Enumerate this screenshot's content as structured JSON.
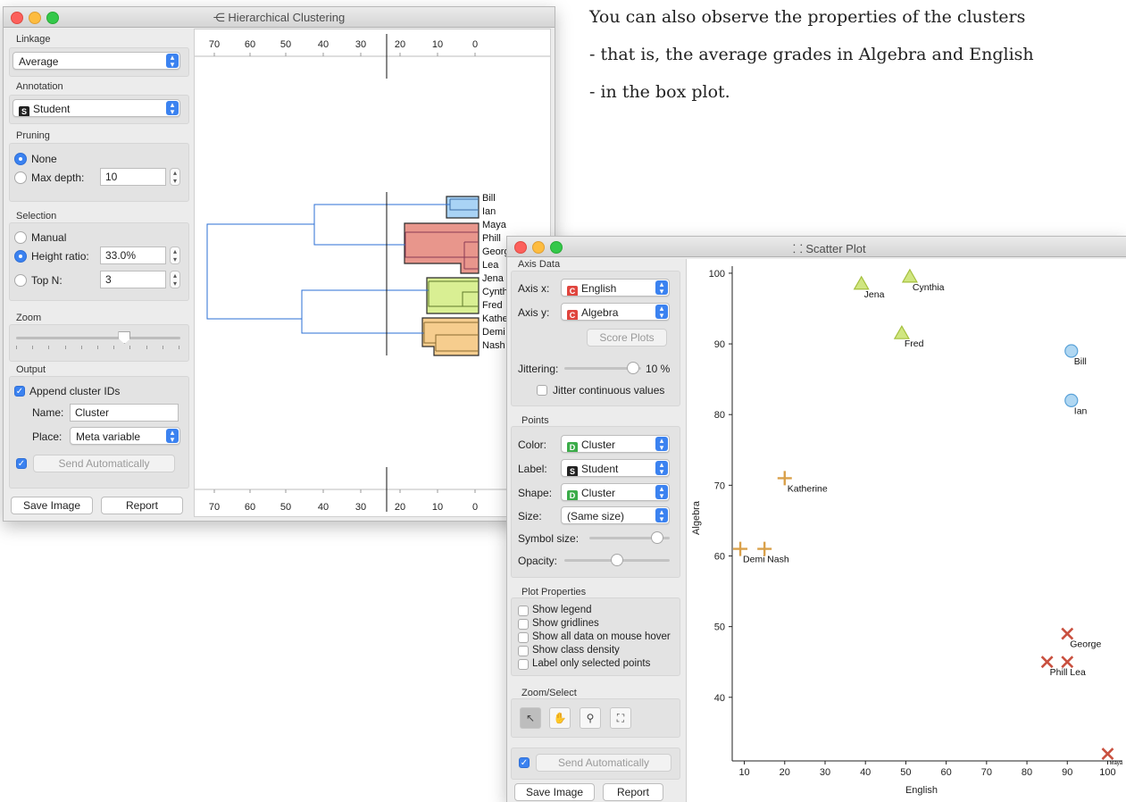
{
  "narrative": {
    "line1": "You can also observe the properties of the clusters",
    "line2": "- that is, the average grades in Algebra and English",
    "line3": "- in the box plot."
  },
  "hc": {
    "title": "Hierarchical Clustering",
    "linkage_label": "Linkage",
    "linkage_value": "Average",
    "annotation_label": "Annotation",
    "annotation_value": "Student",
    "pruning_label": "Pruning",
    "pruning_none": "None",
    "pruning_maxdepth": "Max depth:",
    "pruning_maxdepth_value": "10",
    "selection_label": "Selection",
    "sel_manual": "Manual",
    "sel_height": "Height ratio:",
    "sel_height_value": "33.0%",
    "sel_topn": "Top N:",
    "sel_topn_value": "3",
    "zoom_label": "Zoom",
    "zoom_value": 0.66,
    "output_label": "Output",
    "append_ids": "Append cluster IDs",
    "name_label": "Name:",
    "name_value": "Cluster",
    "place_label": "Place:",
    "place_value": "Meta variable",
    "send_auto": "Send Automatically",
    "save_image": "Save Image",
    "report": "Report",
    "axis_ticks": [
      "70",
      "60",
      "50",
      "40",
      "30",
      "20",
      "10",
      "0"
    ],
    "leaves": [
      "Bill",
      "Ian",
      "Maya",
      "Phill",
      "Georg",
      "Lea",
      "Jena",
      "Cynth",
      "Fred",
      "Kathe",
      "Demi",
      "Nash"
    ],
    "cluster_colors": {
      "blue": "#a9d3f5",
      "red": "#e8968c",
      "green": "#d9ef93",
      "orange": "#f6cd8e"
    }
  },
  "sp": {
    "title": "Scatter Plot",
    "axis_data_label": "Axis Data",
    "axis_x_label": "Axis x:",
    "axis_x_value": "English",
    "axis_y_label": "Axis y:",
    "axis_y_value": "Algebra",
    "score_plots": "Score Plots",
    "jittering_label": "Jittering:",
    "jittering_value": "10 %",
    "jitter_level": 0.9,
    "jitter_cont": "Jitter continuous values",
    "points_label": "Points",
    "color_label": "Color:",
    "color_value": "Cluster",
    "label_label": "Label:",
    "label_value": "Student",
    "shape_label": "Shape:",
    "shape_value": "Cluster",
    "size_label": "Size:",
    "size_value": "(Same size)",
    "symbol_size_label": "Symbol size:",
    "symbol_size_level": 0.84,
    "opacity_label": "Opacity:",
    "opacity_level": 0.5,
    "plot_props_label": "Plot Properties",
    "props": [
      "Show legend",
      "Show gridlines",
      "Show all data on mouse hover",
      "Show class density",
      "Label only selected points"
    ],
    "zoom_select_label": "Zoom/Select",
    "send_auto": "Send Automatically",
    "save_image": "Save Image",
    "report": "Report"
  },
  "chart_data": {
    "type": "scatter",
    "title": "",
    "xlabel": "English",
    "ylabel": "Algebra",
    "xlim": [
      7,
      101
    ],
    "ylim": [
      31,
      101
    ],
    "xticks": [
      10,
      20,
      30,
      40,
      50,
      60,
      70,
      80,
      90,
      100
    ],
    "yticks": [
      40,
      50,
      60,
      70,
      80,
      90,
      100
    ],
    "grid": false,
    "legend": "none",
    "points": [
      {
        "label": "Jena",
        "x": 39,
        "y": 98.5,
        "shape": "triangle",
        "color": "#c8e26a"
      },
      {
        "label": "Cynthia",
        "x": 51,
        "y": 99.5,
        "shape": "triangle",
        "color": "#c8e26a"
      },
      {
        "label": "Fred",
        "x": 49,
        "y": 91.5,
        "shape": "triangle",
        "color": "#c8e26a"
      },
      {
        "label": "Bill",
        "x": 91,
        "y": 89,
        "shape": "circle",
        "color": "#8fc6ec"
      },
      {
        "label": "Ian",
        "x": 91,
        "y": 82,
        "shape": "circle",
        "color": "#8fc6ec"
      },
      {
        "label": "Katherine",
        "x": 20,
        "y": 71,
        "shape": "plus",
        "color": "#d9a04a"
      },
      {
        "label": "Demi",
        "x": 9,
        "y": 61,
        "shape": "plus",
        "color": "#d9a04a"
      },
      {
        "label": "Nash",
        "x": 15,
        "y": 61,
        "shape": "plus",
        "color": "#d9a04a"
      },
      {
        "label": "George",
        "x": 90,
        "y": 49,
        "shape": "cross",
        "color": "#c9503f"
      },
      {
        "label": "Phill",
        "x": 85,
        "y": 45,
        "shape": "cross",
        "color": "#c9503f"
      },
      {
        "label": "Lea",
        "x": 90,
        "y": 45,
        "shape": "cross",
        "color": "#c9503f"
      },
      {
        "label": "Maya",
        "x": 100,
        "y": 32,
        "shape": "cross",
        "color": "#c9503f"
      }
    ]
  }
}
